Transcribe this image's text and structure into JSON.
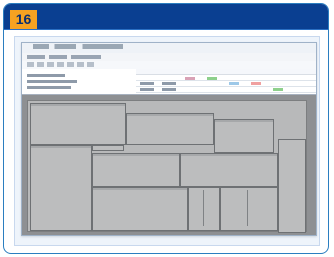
{
  "badge": {
    "step_number": "16"
  },
  "colors": {
    "banner": "#0a3f91",
    "badge": "#f6a221",
    "frame_border": "#2b7ec0",
    "workspace": "#8e9093",
    "plate": "#bcbdbe"
  },
  "screenshot": {
    "window_title": "",
    "menu_items": [
      "",
      "",
      ""
    ],
    "toolbar_icons": [
      "file-icon",
      "save-icon",
      "print-icon",
      "cut-icon",
      "copy-icon",
      "paste-icon",
      "zoom-icon"
    ],
    "spreadsheet": {
      "columns": [
        "",
        "",
        "",
        "",
        "",
        "",
        ""
      ],
      "highlight_colors": [
        "#d9a2b6",
        "#8ed08c",
        "#9dc8e8",
        "#f0a0a0"
      ]
    },
    "layout_panels": [
      {
        "name": "panel-1"
      },
      {
        "name": "panel-2"
      },
      {
        "name": "panel-3"
      },
      {
        "name": "panel-4"
      },
      {
        "name": "panel-5"
      },
      {
        "name": "panel-6"
      },
      {
        "name": "panel-7"
      },
      {
        "name": "panel-8"
      },
      {
        "name": "panel-9"
      },
      {
        "name": "panel-10"
      },
      {
        "name": "panel-11"
      }
    ]
  }
}
